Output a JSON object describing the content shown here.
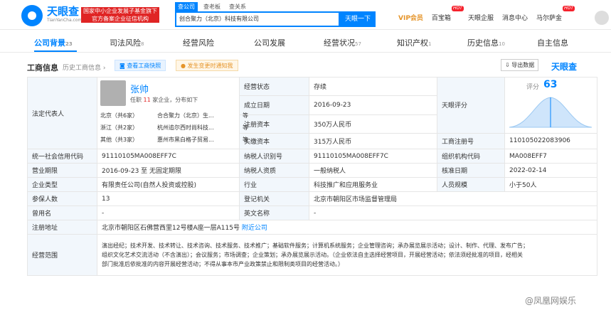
{
  "header": {
    "logo_name": "天眼查",
    "logo_url": "TianYanCha.com",
    "gov_badge_line1": "国家中小企业发展子基金旗下",
    "gov_badge_line2": "官方备案企业征信机构",
    "search_tabs": [
      "查公司",
      "查老板",
      "查关系"
    ],
    "search_value": "创合聚力（北京）科技有限公司",
    "search_button": "天眼一下",
    "vip": "VIP会员",
    "baibaoxiang": "百宝箱",
    "enterprise": "天眼企服",
    "messages": "消息中心",
    "user": "马尔萨金",
    "hot1": "HOT",
    "hot2": "HOT"
  },
  "tabs": [
    {
      "label": "公司背景",
      "count": "23"
    },
    {
      "label": "司法风险",
      "count": "8"
    },
    {
      "label": "经营风险",
      "count": ""
    },
    {
      "label": "公司发展",
      "count": ""
    },
    {
      "label": "经营状况",
      "count": "57"
    },
    {
      "label": "知识产权",
      "count": "1"
    },
    {
      "label": "历史信息",
      "count": "10"
    },
    {
      "label": "自主信息",
      "count": ""
    }
  ],
  "section": {
    "title": "工商信息",
    "history": "历史工商信息",
    "snapshot": "查看工商快照",
    "change_alert": "发生变更时通知我",
    "export": "导出数据",
    "brand": "天眼查"
  },
  "legal": {
    "label": "法定代表人",
    "name": "张帅",
    "summary_prefix": "任职",
    "summary_count": "11",
    "summary_suffix": "家企业，分布如下",
    "dist": [
      {
        "region": "北京（共6家）",
        "company": "合合聚力（北京）生...",
        "etc": "等"
      },
      {
        "region": "浙江（共2家）",
        "company": "杭州追尔西时尚科技...",
        "etc": "等"
      },
      {
        "region": "其他（共3家）",
        "company": "惠州市黑白格子贸易...",
        "etc": "等"
      }
    ]
  },
  "rows_right_top": [
    {
      "label": "经营状态",
      "value": "存续"
    },
    {
      "label": "成立日期",
      "value": "2016-09-23"
    },
    {
      "label": "注册资本",
      "value": "350万人民币"
    },
    {
      "label": "实缴资本",
      "value": "315万人民币"
    }
  ],
  "score": {
    "label": "天眼评分",
    "text": "评分",
    "value": "63"
  },
  "reg_no": {
    "label": "工商注册号",
    "value": "110105022083906"
  },
  "rows": [
    [
      "统一社会信用代码",
      "91110105MA008EFF7C",
      "纳税人识别号",
      "91110105MA008EFF7C",
      "组织机构代码",
      "MA008EFF7"
    ],
    [
      "营业期限",
      "2016-09-23  至 无固定期限",
      "纳税人资质",
      "一般纳税人",
      "核准日期",
      "2022-02-14"
    ],
    [
      "企业类型",
      "有限责任公司(自然人投资或控股)",
      "行业",
      "科技推广和应用服务业",
      "人员规模",
      "小于50人"
    ],
    [
      "参保人数",
      "13",
      "登记机关",
      "北京市朝阳区市场监督管理局",
      "",
      ""
    ],
    [
      "曾用名",
      "-",
      "英文名称",
      "-",
      "",
      ""
    ]
  ],
  "address": {
    "label": "注册地址",
    "value": "北京市朝阳区石佛营西里12号楼A座一层A115号",
    "link": "附近公司"
  },
  "scope": {
    "label": "经营范围",
    "line1": "演出经纪；技术开发、技术转让、技术咨询、技术服务、技术推广；基础软件服务；计算机系统服务；企业管理咨询；承办展览展示活动；设计、制作、代理、发布广告；",
    "line2": "组织文化艺术交流活动（不含演出）；会议服务；市场调查；企业策划；承办展览展示活动。（企业依法自主选择经营项目，开展经营活动；依法须经批准的项目，经相关",
    "line3": "部门批准后依批准的内容开展经营活动；不得从事本市产业政策禁止和限制类项目的经营活动。）"
  },
  "watermark": "@凤凰网娱乐"
}
